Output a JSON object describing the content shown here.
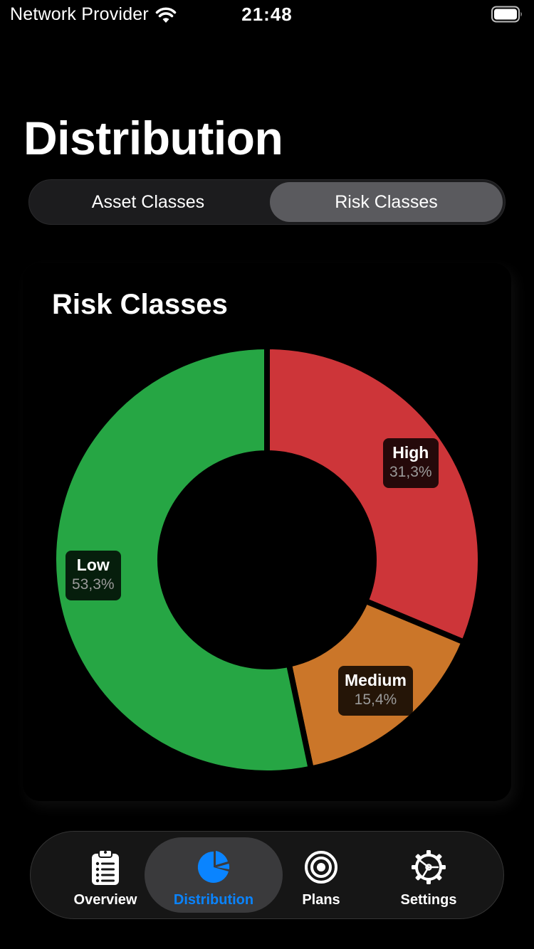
{
  "status_bar": {
    "carrier": "Network Provider",
    "time": "21:48"
  },
  "page": {
    "title": "Distribution"
  },
  "segmented": {
    "options": [
      "Asset Classes",
      "Risk Classes"
    ],
    "selected": "Risk Classes"
  },
  "chart_data": {
    "type": "pie",
    "title": "Risk Classes",
    "donut": true,
    "slices": [
      {
        "label": "High",
        "value": 31.3,
        "value_label": "31,3%",
        "color": "#cd3539"
      },
      {
        "label": "Medium",
        "value": 15.4,
        "value_label": "15,4%",
        "color": "#cb7629"
      },
      {
        "label": "Low",
        "value": 53.3,
        "value_label": "53,3%",
        "color": "#26a644"
      }
    ]
  },
  "tab_bar": {
    "items": [
      {
        "label": "Overview",
        "icon": "clipboard-list-icon"
      },
      {
        "label": "Distribution",
        "icon": "pie-chart-icon"
      },
      {
        "label": "Plans",
        "icon": "target-icon"
      },
      {
        "label": "Settings",
        "icon": "gear-icon"
      }
    ],
    "active": "Distribution",
    "active_color": "#0a84ff"
  }
}
